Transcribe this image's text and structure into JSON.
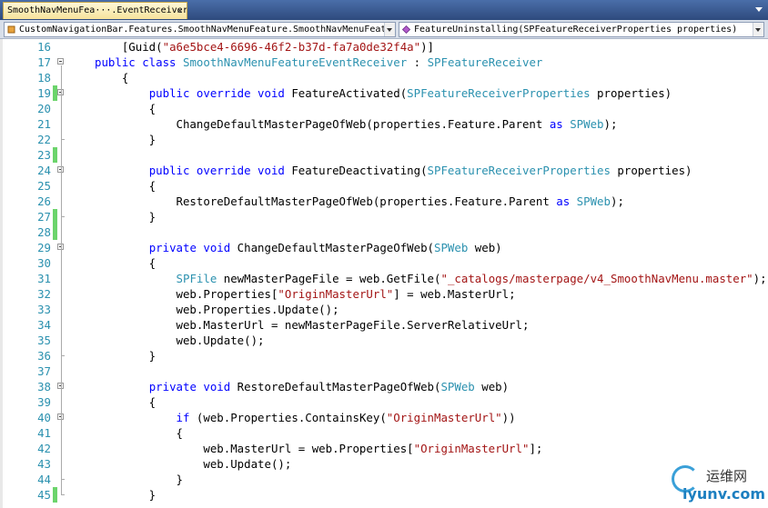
{
  "tab": {
    "title": "SmoothNavMenuFea···.EventReceiver.cs",
    "close": "×"
  },
  "navbar": {
    "type_combo": "CustomNavigationBar.Features.SmoothNavMenuFeature.SmoothNavMenuFeatureEventRec",
    "member_combo": "FeatureUninstalling(SPFeatureReceiverProperties properties)"
  },
  "watermark": {
    "cn": "运维网",
    "en": "iyunv.com"
  },
  "lines": [
    {
      "n": "16",
      "tokens": [
        [
          "p",
          "    [Guid("
        ],
        [
          "s",
          "\"a6e5bce4-6696-46f2-b37d-fa7a0de32f4a\""
        ],
        [
          "p",
          ")]"
        ]
      ]
    },
    {
      "n": "17",
      "fold": true,
      "tokens": [
        [
          "k",
          "public class "
        ],
        [
          "t",
          "SmoothNavMenuFeatureEventReceiver"
        ],
        [
          "p",
          " : "
        ],
        [
          "t",
          "SPFeatureReceiver"
        ]
      ]
    },
    {
      "n": "18",
      "tokens": [
        [
          "p",
          "    {"
        ]
      ]
    },
    {
      "n": "19",
      "fold": true,
      "chg": true,
      "tokens": [
        [
          "p",
          "        "
        ],
        [
          "k",
          "public override void "
        ],
        [
          "p",
          "FeatureActivated("
        ],
        [
          "t",
          "SPFeatureReceiverProperties"
        ],
        [
          "p",
          " properties)"
        ]
      ]
    },
    {
      "n": "20",
      "tokens": [
        [
          "p",
          "        {"
        ]
      ]
    },
    {
      "n": "21",
      "tokens": [
        [
          "p",
          "            ChangeDefaultMasterPageOfWeb(properties.Feature.Parent "
        ],
        [
          "k",
          "as "
        ],
        [
          "t",
          "SPWeb"
        ],
        [
          "p",
          ");"
        ]
      ]
    },
    {
      "n": "22",
      "tokens": [
        [
          "p",
          "        }"
        ]
      ]
    },
    {
      "n": "23",
      "chg": true,
      "tokens": [
        [
          "p",
          ""
        ]
      ]
    },
    {
      "n": "24",
      "fold": true,
      "tokens": [
        [
          "p",
          "        "
        ],
        [
          "k",
          "public override void "
        ],
        [
          "p",
          "FeatureDeactivating("
        ],
        [
          "t",
          "SPFeatureReceiverProperties"
        ],
        [
          "p",
          " properties)"
        ]
      ]
    },
    {
      "n": "25",
      "tokens": [
        [
          "p",
          "        {"
        ]
      ]
    },
    {
      "n": "26",
      "tokens": [
        [
          "p",
          "            RestoreDefaultMasterPageOfWeb(properties.Feature.Parent "
        ],
        [
          "k",
          "as "
        ],
        [
          "t",
          "SPWeb"
        ],
        [
          "p",
          ");"
        ]
      ]
    },
    {
      "n": "27",
      "chg": true,
      "tokens": [
        [
          "p",
          "        }"
        ]
      ]
    },
    {
      "n": "28",
      "chg": true,
      "tokens": [
        [
          "p",
          ""
        ]
      ]
    },
    {
      "n": "29",
      "fold": true,
      "tokens": [
        [
          "p",
          "        "
        ],
        [
          "k",
          "private void "
        ],
        [
          "p",
          "ChangeDefaultMasterPageOfWeb("
        ],
        [
          "t",
          "SPWeb"
        ],
        [
          "p",
          " web)"
        ]
      ]
    },
    {
      "n": "30",
      "tokens": [
        [
          "p",
          "        {"
        ]
      ]
    },
    {
      "n": "31",
      "tokens": [
        [
          "p",
          "            "
        ],
        [
          "t",
          "SPFile"
        ],
        [
          "p",
          " newMasterPageFile = web.GetFile("
        ],
        [
          "s",
          "\"_catalogs/masterpage/v4_SmoothNavMenu.master\""
        ],
        [
          "p",
          ");"
        ]
      ]
    },
    {
      "n": "32",
      "tokens": [
        [
          "p",
          "            web.Properties["
        ],
        [
          "s",
          "\"OriginMasterUrl\""
        ],
        [
          "p",
          "] = web.MasterUrl;"
        ]
      ]
    },
    {
      "n": "33",
      "tokens": [
        [
          "p",
          "            web.Properties.Update();"
        ]
      ]
    },
    {
      "n": "34",
      "tokens": [
        [
          "p",
          "            web.MasterUrl = newMasterPageFile.ServerRelativeUrl;"
        ]
      ]
    },
    {
      "n": "35",
      "tokens": [
        [
          "p",
          "            web.Update();"
        ]
      ]
    },
    {
      "n": "36",
      "tokens": [
        [
          "p",
          "        }"
        ]
      ]
    },
    {
      "n": "37",
      "tokens": [
        [
          "p",
          ""
        ]
      ]
    },
    {
      "n": "38",
      "fold": true,
      "tokens": [
        [
          "p",
          "        "
        ],
        [
          "k",
          "private void "
        ],
        [
          "p",
          "RestoreDefaultMasterPageOfWeb("
        ],
        [
          "t",
          "SPWeb"
        ],
        [
          "p",
          " web)"
        ]
      ]
    },
    {
      "n": "39",
      "tokens": [
        [
          "p",
          "        {"
        ]
      ]
    },
    {
      "n": "40",
      "fold": true,
      "tokens": [
        [
          "p",
          "            "
        ],
        [
          "k",
          "if "
        ],
        [
          "p",
          "(web.Properties.ContainsKey("
        ],
        [
          "s",
          "\"OriginMasterUrl\""
        ],
        [
          "p",
          "))"
        ]
      ]
    },
    {
      "n": "41",
      "tokens": [
        [
          "p",
          "            {"
        ]
      ]
    },
    {
      "n": "42",
      "tokens": [
        [
          "p",
          "                web.MasterUrl = web.Properties["
        ],
        [
          "s",
          "\"OriginMasterUrl\""
        ],
        [
          "p",
          "];"
        ]
      ]
    },
    {
      "n": "43",
      "tokens": [
        [
          "p",
          "                web.Update();"
        ]
      ]
    },
    {
      "n": "44",
      "tokens": [
        [
          "p",
          "            }"
        ]
      ]
    },
    {
      "n": "45",
      "chg": true,
      "tokens": [
        [
          "p",
          "        }"
        ]
      ]
    }
  ]
}
